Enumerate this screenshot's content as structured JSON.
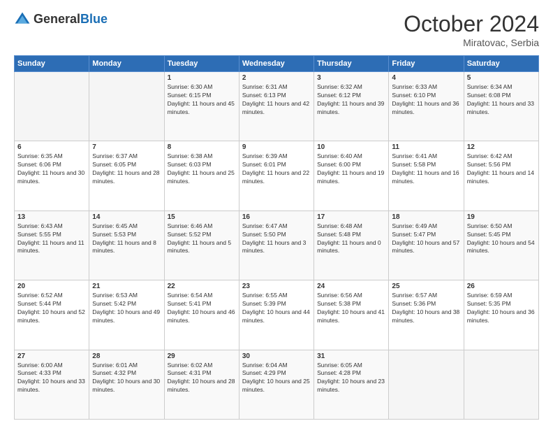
{
  "header": {
    "logo_general": "General",
    "logo_blue": "Blue",
    "month_year": "October 2024",
    "location": "Miratovac, Serbia"
  },
  "weekdays": [
    "Sunday",
    "Monday",
    "Tuesday",
    "Wednesday",
    "Thursday",
    "Friday",
    "Saturday"
  ],
  "weeks": [
    [
      {
        "day": "",
        "sunrise": "",
        "sunset": "",
        "daylight": ""
      },
      {
        "day": "",
        "sunrise": "",
        "sunset": "",
        "daylight": ""
      },
      {
        "day": "1",
        "sunrise": "Sunrise: 6:30 AM",
        "sunset": "Sunset: 6:15 PM",
        "daylight": "Daylight: 11 hours and 45 minutes."
      },
      {
        "day": "2",
        "sunrise": "Sunrise: 6:31 AM",
        "sunset": "Sunset: 6:13 PM",
        "daylight": "Daylight: 11 hours and 42 minutes."
      },
      {
        "day": "3",
        "sunrise": "Sunrise: 6:32 AM",
        "sunset": "Sunset: 6:12 PM",
        "daylight": "Daylight: 11 hours and 39 minutes."
      },
      {
        "day": "4",
        "sunrise": "Sunrise: 6:33 AM",
        "sunset": "Sunset: 6:10 PM",
        "daylight": "Daylight: 11 hours and 36 minutes."
      },
      {
        "day": "5",
        "sunrise": "Sunrise: 6:34 AM",
        "sunset": "Sunset: 6:08 PM",
        "daylight": "Daylight: 11 hours and 33 minutes."
      }
    ],
    [
      {
        "day": "6",
        "sunrise": "Sunrise: 6:35 AM",
        "sunset": "Sunset: 6:06 PM",
        "daylight": "Daylight: 11 hours and 30 minutes."
      },
      {
        "day": "7",
        "sunrise": "Sunrise: 6:37 AM",
        "sunset": "Sunset: 6:05 PM",
        "daylight": "Daylight: 11 hours and 28 minutes."
      },
      {
        "day": "8",
        "sunrise": "Sunrise: 6:38 AM",
        "sunset": "Sunset: 6:03 PM",
        "daylight": "Daylight: 11 hours and 25 minutes."
      },
      {
        "day": "9",
        "sunrise": "Sunrise: 6:39 AM",
        "sunset": "Sunset: 6:01 PM",
        "daylight": "Daylight: 11 hours and 22 minutes."
      },
      {
        "day": "10",
        "sunrise": "Sunrise: 6:40 AM",
        "sunset": "Sunset: 6:00 PM",
        "daylight": "Daylight: 11 hours and 19 minutes."
      },
      {
        "day": "11",
        "sunrise": "Sunrise: 6:41 AM",
        "sunset": "Sunset: 5:58 PM",
        "daylight": "Daylight: 11 hours and 16 minutes."
      },
      {
        "day": "12",
        "sunrise": "Sunrise: 6:42 AM",
        "sunset": "Sunset: 5:56 PM",
        "daylight": "Daylight: 11 hours and 14 minutes."
      }
    ],
    [
      {
        "day": "13",
        "sunrise": "Sunrise: 6:43 AM",
        "sunset": "Sunset: 5:55 PM",
        "daylight": "Daylight: 11 hours and 11 minutes."
      },
      {
        "day": "14",
        "sunrise": "Sunrise: 6:45 AM",
        "sunset": "Sunset: 5:53 PM",
        "daylight": "Daylight: 11 hours and 8 minutes."
      },
      {
        "day": "15",
        "sunrise": "Sunrise: 6:46 AM",
        "sunset": "Sunset: 5:52 PM",
        "daylight": "Daylight: 11 hours and 5 minutes."
      },
      {
        "day": "16",
        "sunrise": "Sunrise: 6:47 AM",
        "sunset": "Sunset: 5:50 PM",
        "daylight": "Daylight: 11 hours and 3 minutes."
      },
      {
        "day": "17",
        "sunrise": "Sunrise: 6:48 AM",
        "sunset": "Sunset: 5:48 PM",
        "daylight": "Daylight: 11 hours and 0 minutes."
      },
      {
        "day": "18",
        "sunrise": "Sunrise: 6:49 AM",
        "sunset": "Sunset: 5:47 PM",
        "daylight": "Daylight: 10 hours and 57 minutes."
      },
      {
        "day": "19",
        "sunrise": "Sunrise: 6:50 AM",
        "sunset": "Sunset: 5:45 PM",
        "daylight": "Daylight: 10 hours and 54 minutes."
      }
    ],
    [
      {
        "day": "20",
        "sunrise": "Sunrise: 6:52 AM",
        "sunset": "Sunset: 5:44 PM",
        "daylight": "Daylight: 10 hours and 52 minutes."
      },
      {
        "day": "21",
        "sunrise": "Sunrise: 6:53 AM",
        "sunset": "Sunset: 5:42 PM",
        "daylight": "Daylight: 10 hours and 49 minutes."
      },
      {
        "day": "22",
        "sunrise": "Sunrise: 6:54 AM",
        "sunset": "Sunset: 5:41 PM",
        "daylight": "Daylight: 10 hours and 46 minutes."
      },
      {
        "day": "23",
        "sunrise": "Sunrise: 6:55 AM",
        "sunset": "Sunset: 5:39 PM",
        "daylight": "Daylight: 10 hours and 44 minutes."
      },
      {
        "day": "24",
        "sunrise": "Sunrise: 6:56 AM",
        "sunset": "Sunset: 5:38 PM",
        "daylight": "Daylight: 10 hours and 41 minutes."
      },
      {
        "day": "25",
        "sunrise": "Sunrise: 6:57 AM",
        "sunset": "Sunset: 5:36 PM",
        "daylight": "Daylight: 10 hours and 38 minutes."
      },
      {
        "day": "26",
        "sunrise": "Sunrise: 6:59 AM",
        "sunset": "Sunset: 5:35 PM",
        "daylight": "Daylight: 10 hours and 36 minutes."
      }
    ],
    [
      {
        "day": "27",
        "sunrise": "Sunrise: 6:00 AM",
        "sunset": "Sunset: 4:33 PM",
        "daylight": "Daylight: 10 hours and 33 minutes."
      },
      {
        "day": "28",
        "sunrise": "Sunrise: 6:01 AM",
        "sunset": "Sunset: 4:32 PM",
        "daylight": "Daylight: 10 hours and 30 minutes."
      },
      {
        "day": "29",
        "sunrise": "Sunrise: 6:02 AM",
        "sunset": "Sunset: 4:31 PM",
        "daylight": "Daylight: 10 hours and 28 minutes."
      },
      {
        "day": "30",
        "sunrise": "Sunrise: 6:04 AM",
        "sunset": "Sunset: 4:29 PM",
        "daylight": "Daylight: 10 hours and 25 minutes."
      },
      {
        "day": "31",
        "sunrise": "Sunrise: 6:05 AM",
        "sunset": "Sunset: 4:28 PM",
        "daylight": "Daylight: 10 hours and 23 minutes."
      },
      {
        "day": "",
        "sunrise": "",
        "sunset": "",
        "daylight": ""
      },
      {
        "day": "",
        "sunrise": "",
        "sunset": "",
        "daylight": ""
      }
    ]
  ]
}
